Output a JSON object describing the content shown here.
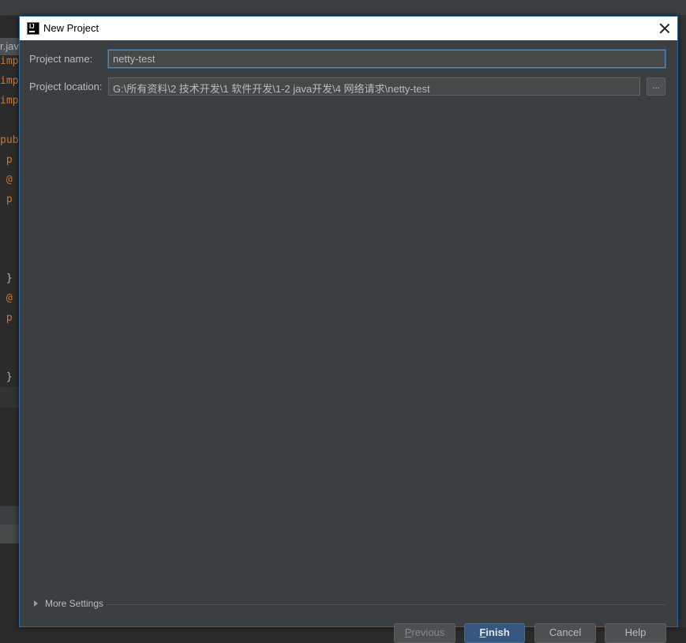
{
  "background_ide": {
    "tab_label": "r.java",
    "code_lines": [
      {
        "text": "impor",
        "kind": "kw"
      },
      {
        "text": "impor",
        "kind": "kw"
      },
      {
        "text": "impor",
        "kind": "kw"
      },
      {
        "text": "",
        "kind": "plain"
      },
      {
        "text": "publi",
        "kind": "kw"
      },
      {
        "text": " p",
        "kind": "kw"
      },
      {
        "text": " @",
        "kind": "kw"
      },
      {
        "text": " p",
        "kind": "kw"
      },
      {
        "text": "",
        "kind": "plain"
      },
      {
        "text": "",
        "kind": "plain"
      },
      {
        "text": "",
        "kind": "plain"
      },
      {
        "text": " }",
        "kind": "plain"
      },
      {
        "text": " @",
        "kind": "kw"
      },
      {
        "text": " p",
        "kind": "kw"
      },
      {
        "text": "",
        "kind": "plain"
      },
      {
        "text": "",
        "kind": "plain"
      },
      {
        "text": " }",
        "kind": "plain"
      }
    ]
  },
  "dialog": {
    "title": "New Project",
    "icon": "intellij-idea-icon",
    "fields": {
      "project_name_label": "Project name:",
      "project_name_value": "netty-test",
      "project_location_label": "Project location:",
      "project_location_value": "G:\\所有资料\\2 技术开发\\1 软件开发\\1-2 java开发\\4 网络请求\\netty-test",
      "browse_label": "..."
    },
    "more_settings_label": "More Settings",
    "buttons": {
      "previous": {
        "mnemonic": "P",
        "rest": "revious",
        "enabled": false
      },
      "finish": {
        "mnemonic": "F",
        "rest": "inish",
        "default": true
      },
      "cancel": "Cancel",
      "help": "Help"
    }
  },
  "colors": {
    "dialog_bg": "#3c3f41",
    "field_bg": "#45494a",
    "focus_border": "#4a88c7",
    "default_button": "#365880",
    "text": "#bbbbbb",
    "keyword": "#cc7832"
  }
}
